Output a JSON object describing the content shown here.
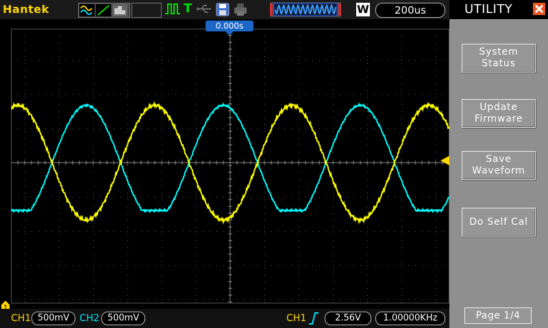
{
  "brand": "Hantek",
  "status": {
    "trigger_indicator": "T",
    "acquisition_mode": "W",
    "timebase": "200us",
    "trigger_position": "0.000s"
  },
  "channels": {
    "ch1": {
      "label": "CH1",
      "scale": "500mV",
      "color": "#ffff00"
    },
    "ch2": {
      "label": "CH2",
      "scale": "500mV",
      "color": "#00ffff"
    }
  },
  "trigger": {
    "source": "CH1",
    "level": "2.56V",
    "frequency": "1.00000KHz"
  },
  "menu": {
    "title": "UTILITY",
    "items": [
      {
        "label_line1": "System",
        "label_line2": "Status"
      },
      {
        "label_line1": "Update",
        "label_line2": "Firmware"
      },
      {
        "label_line1": "Save",
        "label_line2": "Waveform"
      },
      {
        "label_line1": "Do Self Cal",
        "label_line2": ""
      }
    ],
    "page": "Page 1/4"
  },
  "colors": {
    "accent_blue": "#1c66c8",
    "brand_yellow": "#ffd700",
    "close_orange": "#e8551f"
  },
  "icons": {
    "mode_icons": [
      "waveform-mode-icon",
      "xy-mode-icon",
      "persist-mode-icon"
    ],
    "trigger_type": "pulse-trigger-icon",
    "usb": "usb-icon",
    "save": "floppy-disk-icon",
    "print": "printer-icon",
    "close": "close-icon",
    "trigger_edge": "rising-edge-icon"
  }
}
